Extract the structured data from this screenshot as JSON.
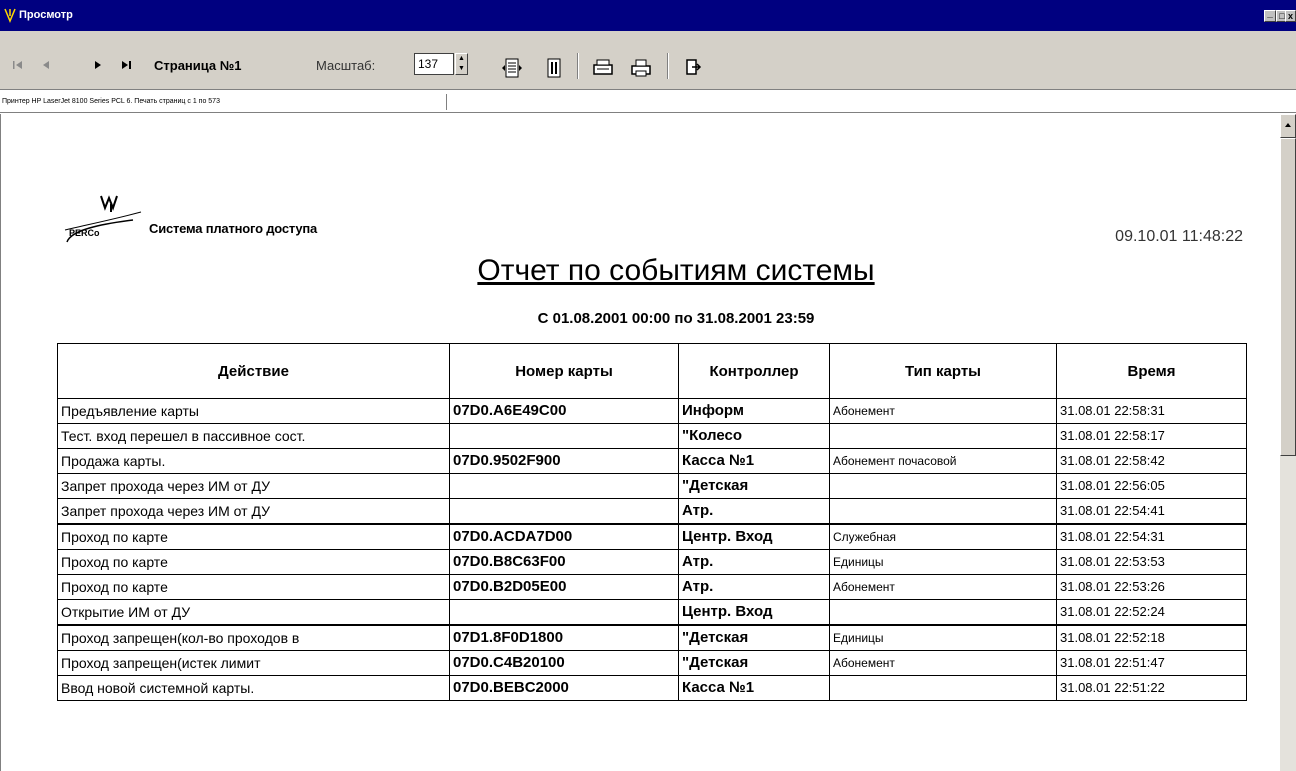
{
  "window": {
    "title": "Просмотр",
    "min": "_",
    "max": "□",
    "close": "x"
  },
  "toolbar": {
    "first": "◄",
    "prev": "◄",
    "next": "►",
    "last": "►",
    "page_label": "Страница №1",
    "zoom_label": "Масштаб:",
    "zoom_value": "137",
    "spin_up": "▲",
    "spin_down": "▼"
  },
  "statusbar": {
    "text": "Принтер HP LaserJet 8100 Series PCL 6. Печать страниц с 1 по 573"
  },
  "report": {
    "company": "Система платного доступа",
    "datetime": "09.10.01 11:48:22",
    "title": "Отчет по событиям системы",
    "period": "С 01.08.2001  00:00  по  31.08.2001  23:59",
    "columns": [
      "Действие",
      "Номер карты",
      "Контроллер",
      "Тип карты",
      "Время"
    ],
    "rows": [
      {
        "action": "Предъявление карты",
        "card": "07D0.A6E49C00",
        "ctrl": "Информ",
        "type": "Абонемент",
        "time": "31.08.01 22:58:31"
      },
      {
        "action": "Тест. вход перешел в пассивное сост.",
        "card": "",
        "ctrl": "\"Колесо",
        "type": "",
        "time": "31.08.01 22:58:17"
      },
      {
        "action": "Продажа карты.",
        "card": "07D0.9502F900",
        "ctrl": "Касса №1",
        "type": "Абонемент почасовой",
        "time": "31.08.01 22:58:42"
      },
      {
        "action": "Запрет прохода через ИМ от ДУ",
        "card": "",
        "ctrl": "\"Детская",
        "type": "",
        "time": "31.08.01 22:56:05"
      },
      {
        "action": "Запрет прохода через ИМ от ДУ",
        "card": "",
        "ctrl": "Атр.",
        "type": "",
        "time": "31.08.01 22:54:41"
      },
      {
        "action": "Проход по карте",
        "card": "07D0.ACDA7D00",
        "ctrl": "Центр. Вход",
        "type": "Служебная",
        "time": "31.08.01 22:54:31"
      },
      {
        "action": "Проход по карте",
        "card": "07D0.B8C63F00",
        "ctrl": "Атр.",
        "type": "Единицы",
        "time": "31.08.01 22:53:53"
      },
      {
        "action": "Проход по карте",
        "card": "07D0.B2D05E00",
        "ctrl": "Атр.",
        "type": "Абонемент",
        "time": "31.08.01 22:53:26"
      },
      {
        "action": "Открытие ИМ от ДУ",
        "card": "",
        "ctrl": "Центр. Вход",
        "type": "",
        "time": "31.08.01 22:52:24"
      },
      {
        "action": "Проход запрещен(кол-во проходов в",
        "card": "07D1.8F0D1800",
        "ctrl": "\"Детская",
        "type": "Единицы",
        "time": "31.08.01 22:52:18"
      },
      {
        "action": "Проход запрещен(истек лимит",
        "card": "07D0.C4B20100",
        "ctrl": "\"Детская",
        "type": "Абонемент",
        "time": "31.08.01 22:51:47"
      },
      {
        "action": "Ввод новой системной карты.",
        "card": "07D0.BEBC2000",
        "ctrl": "Касса №1",
        "type": "",
        "time": "31.08.01 22:51:22"
      }
    ]
  }
}
